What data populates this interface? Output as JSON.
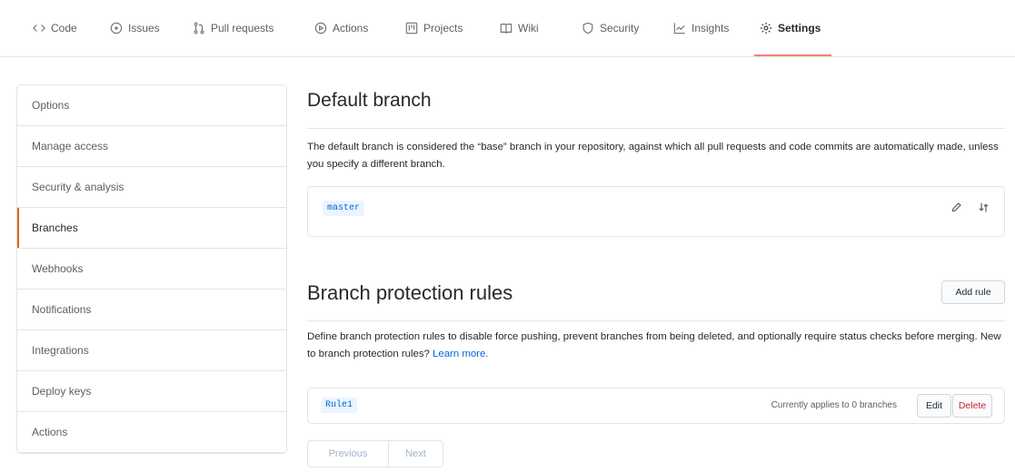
{
  "repo_nav": {
    "tabs": [
      {
        "label": "Code",
        "icon": "code-icon"
      },
      {
        "label": "Issues",
        "icon": "issue-icon"
      },
      {
        "label": "Pull requests",
        "icon": "pull-request-icon"
      },
      {
        "label": "Actions",
        "icon": "play-icon"
      },
      {
        "label": "Projects",
        "icon": "project-icon"
      },
      {
        "label": "Wiki",
        "icon": "book-icon"
      },
      {
        "label": "Security",
        "icon": "shield-icon"
      },
      {
        "label": "Insights",
        "icon": "graph-icon"
      },
      {
        "label": "Settings",
        "icon": "gear-icon",
        "active": true
      }
    ]
  },
  "sidebar": {
    "items": [
      {
        "label": "Options"
      },
      {
        "label": "Manage access"
      },
      {
        "label": "Security & analysis"
      },
      {
        "label": "Branches",
        "selected": true
      },
      {
        "label": "Webhooks"
      },
      {
        "label": "Notifications"
      },
      {
        "label": "Integrations"
      },
      {
        "label": "Deploy keys"
      },
      {
        "label": "Actions"
      }
    ]
  },
  "default_branch": {
    "title": "Default branch",
    "description": "The default branch is considered the “base” branch in your repository, against which all pull requests and code commits are automatically made, unless you specify a different branch.",
    "branch": "master",
    "edit_icon": "pencil-icon",
    "switch_icon": "arrow-switch-icon"
  },
  "protection": {
    "title": "Branch protection rules",
    "add_rule_label": "Add rule",
    "description": "Define branch protection rules to disable force pushing, prevent branches from being deleted, and optionally require status checks before merging. New to branch protection rules?",
    "learn_more": "Learn more.",
    "rule": {
      "name": "Rule1",
      "applies_text": "Currently applies to 0 branches",
      "edit_label": "Edit",
      "delete_label": "Delete"
    }
  },
  "pagination": {
    "previous": "Previous",
    "next": "Next"
  },
  "colors": {
    "accent": "#f9826c",
    "link": "#0366d6",
    "danger": "#cb2431"
  }
}
